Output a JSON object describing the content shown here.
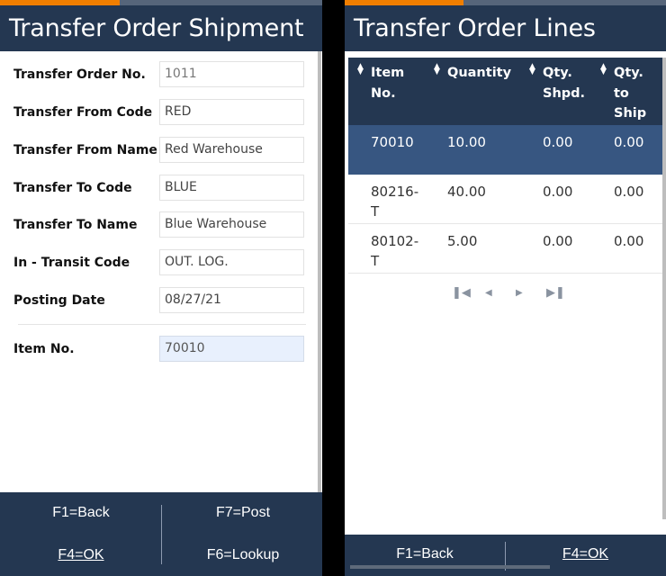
{
  "left": {
    "title": "Transfer Order Shipment",
    "fields": [
      {
        "label": "Transfer Order No.",
        "value": "1011"
      },
      {
        "label": "Transfer From Code",
        "value": "RED"
      },
      {
        "label": "Transfer From Name",
        "value": "Red Warehouse"
      },
      {
        "label": "Transfer To Code",
        "value": "BLUE"
      },
      {
        "label": "Transfer To Name",
        "value": "Blue Warehouse"
      },
      {
        "label": "In - Transit Code",
        "value": "OUT. LOG."
      },
      {
        "label": "Posting Date",
        "value": "08/27/21"
      }
    ],
    "item_field": {
      "label": "Item No.",
      "value": "70010"
    },
    "footer": {
      "back": "F1=Back",
      "post": "F7=Post",
      "ok": "F4=OK",
      "lookup": "F6=Lookup"
    }
  },
  "right": {
    "title": "Transfer Order Lines",
    "columns": [
      "Item No.",
      "Quantity",
      "Qty. Shpd.",
      "Qty. to Ship"
    ],
    "column_lines": [
      [
        "Item",
        "No."
      ],
      [
        "Quantity"
      ],
      [
        "Qty.",
        "Shpd."
      ],
      [
        "Qty.",
        "to",
        "Ship"
      ]
    ],
    "rows": [
      {
        "item_no": "70010",
        "quantity": "10.00",
        "qty_shpd": "0.00",
        "qty_to_ship": "0.00",
        "selected": true
      },
      {
        "item_no": "80216-T",
        "item_lines": [
          "80216-",
          "T"
        ],
        "quantity": "40.00",
        "qty_shpd": "0.00",
        "qty_to_ship": "0.00"
      },
      {
        "item_no": "80102-T",
        "item_lines": [
          "80102-",
          "T"
        ],
        "quantity": "5.00",
        "qty_shpd": "0.00",
        "qty_to_ship": "0.00"
      }
    ],
    "pager": {
      "first": "first-page",
      "prev": "prev-page",
      "next": "next-page",
      "last": "last-page"
    },
    "footer": {
      "back": "F1=Back",
      "ok": "F4=OK"
    }
  },
  "colors": {
    "header_bg": "#243751",
    "accent_orange": "#f07e00",
    "selected_row": "#375681",
    "active_input": "#e8f0fd"
  }
}
